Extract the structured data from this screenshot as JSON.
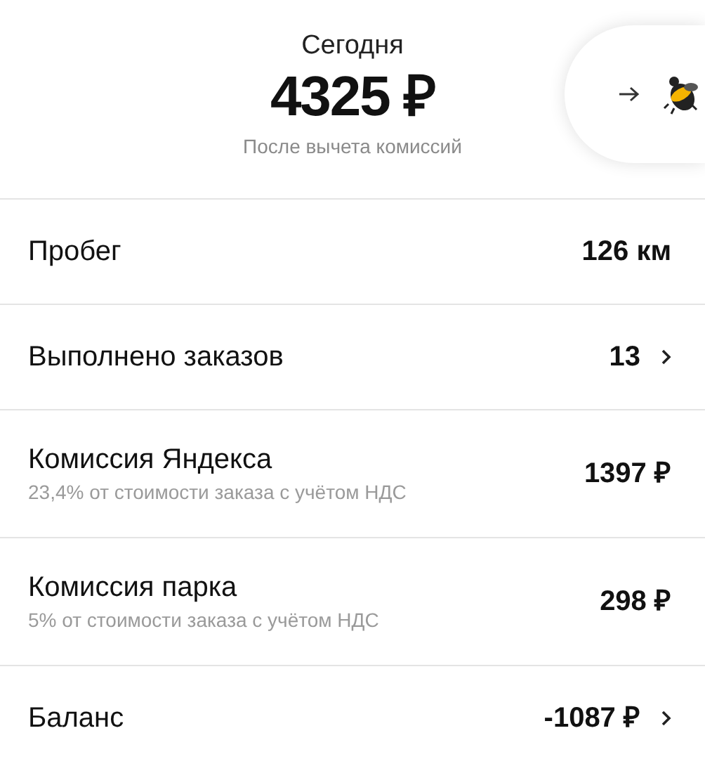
{
  "header": {
    "title": "Сегодня",
    "amount": "4325 ₽",
    "subtitle": "После вычета комиссий"
  },
  "rows": [
    {
      "label": "Пробег",
      "value": "126 км",
      "chevron": false
    },
    {
      "label": "Выполнено заказов",
      "value": "13",
      "chevron": true
    },
    {
      "label": "Комиссия Яндекса",
      "note": "23,4% от стоимости заказа с учётом НДС",
      "value": "1397 ₽",
      "chevron": false
    },
    {
      "label": "Комиссия парка",
      "note": "5% от стоимости заказа с учётом НДС",
      "value": "298 ₽",
      "chevron": false
    },
    {
      "label": "Баланс",
      "value": "-1087 ₽",
      "chevron": true
    }
  ]
}
